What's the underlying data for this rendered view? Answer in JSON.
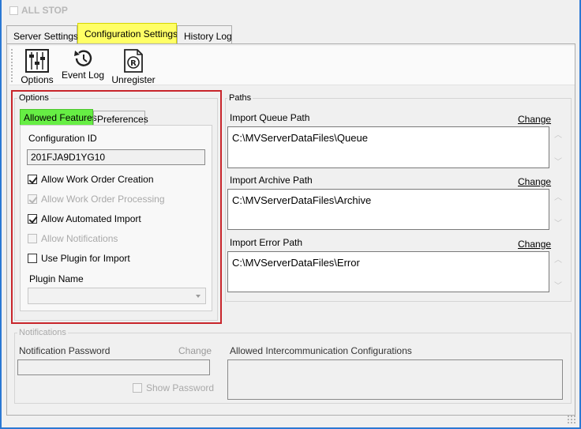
{
  "window": {
    "all_stop_label": "ALL STOP"
  },
  "tabs": [
    {
      "label": "Server Settings",
      "active": false
    },
    {
      "label": "Configuration Settings",
      "active": true
    },
    {
      "label": "History Log",
      "active": false
    }
  ],
  "toolbar": {
    "options_label": "Options",
    "event_log_label": "Event Log",
    "unregister_label": "Unregister"
  },
  "options": {
    "group_label": "Options",
    "subtabs": [
      {
        "label": "Allowed Features",
        "active": true
      },
      {
        "label": "Preferences",
        "active": false
      }
    ],
    "config_id_label": "Configuration ID",
    "config_id_value": "201FJA9D1YG10",
    "checks": [
      {
        "label": "Allow Work Order Creation",
        "checked": true,
        "enabled": true
      },
      {
        "label": "Allow Work Order Processing",
        "checked": true,
        "enabled": false
      },
      {
        "label": "Allow Automated Import",
        "checked": true,
        "enabled": true
      },
      {
        "label": "Allow Notifications",
        "checked": false,
        "enabled": false
      },
      {
        "label": "Use Plugin for Import",
        "checked": false,
        "enabled": true
      }
    ],
    "plugin_name_label": "Plugin Name",
    "plugin_name_value": ""
  },
  "paths": {
    "group_label": "Paths",
    "change_label": "Change",
    "items": [
      {
        "label": "Import Queue Path",
        "value": "C:\\MVServerDataFiles\\Queue"
      },
      {
        "label": "Import Archive Path",
        "value": "C:\\MVServerDataFiles\\Archive"
      },
      {
        "label": "Import Error Path",
        "value": "C:\\MVServerDataFiles\\Error"
      }
    ]
  },
  "notifications": {
    "group_label": "Notifications",
    "password_label": "Notification Password",
    "change_label": "Change",
    "password_value": "",
    "show_password_label": "Show Password",
    "allowed_intercomm_label": "Allowed Intercommunication Configurations"
  },
  "colors": {
    "active_tab": "#ffff66",
    "active_subtab": "#66ee44",
    "highlight_border": "#c8252b",
    "window_border": "#2b78d4"
  }
}
